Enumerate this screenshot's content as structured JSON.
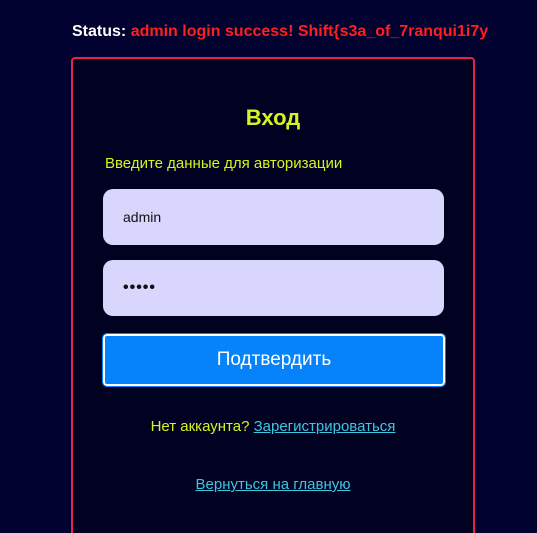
{
  "status": {
    "label": "Status:",
    "message": "admin login success! Shift{s3a_of_7ranqui1i7y"
  },
  "login": {
    "title": "Вход",
    "subtitle": "Введите данные для авторизации",
    "username_value": "admin",
    "password_masked": "•••••",
    "submit_label": "Подтвердить",
    "no_account_text": "Нет аккаунта?",
    "register_link": "Зарегистрироваться",
    "home_link": "Вернуться на главную"
  },
  "colors": {
    "background": "#020230",
    "card_border": "#e8204a",
    "accent_yellow": "#d4f520",
    "status_red": "#ff1f1f",
    "button_blue": "#0683fb",
    "link_cyan": "#3ec6e0",
    "input_bg": "#d8d6fc"
  }
}
